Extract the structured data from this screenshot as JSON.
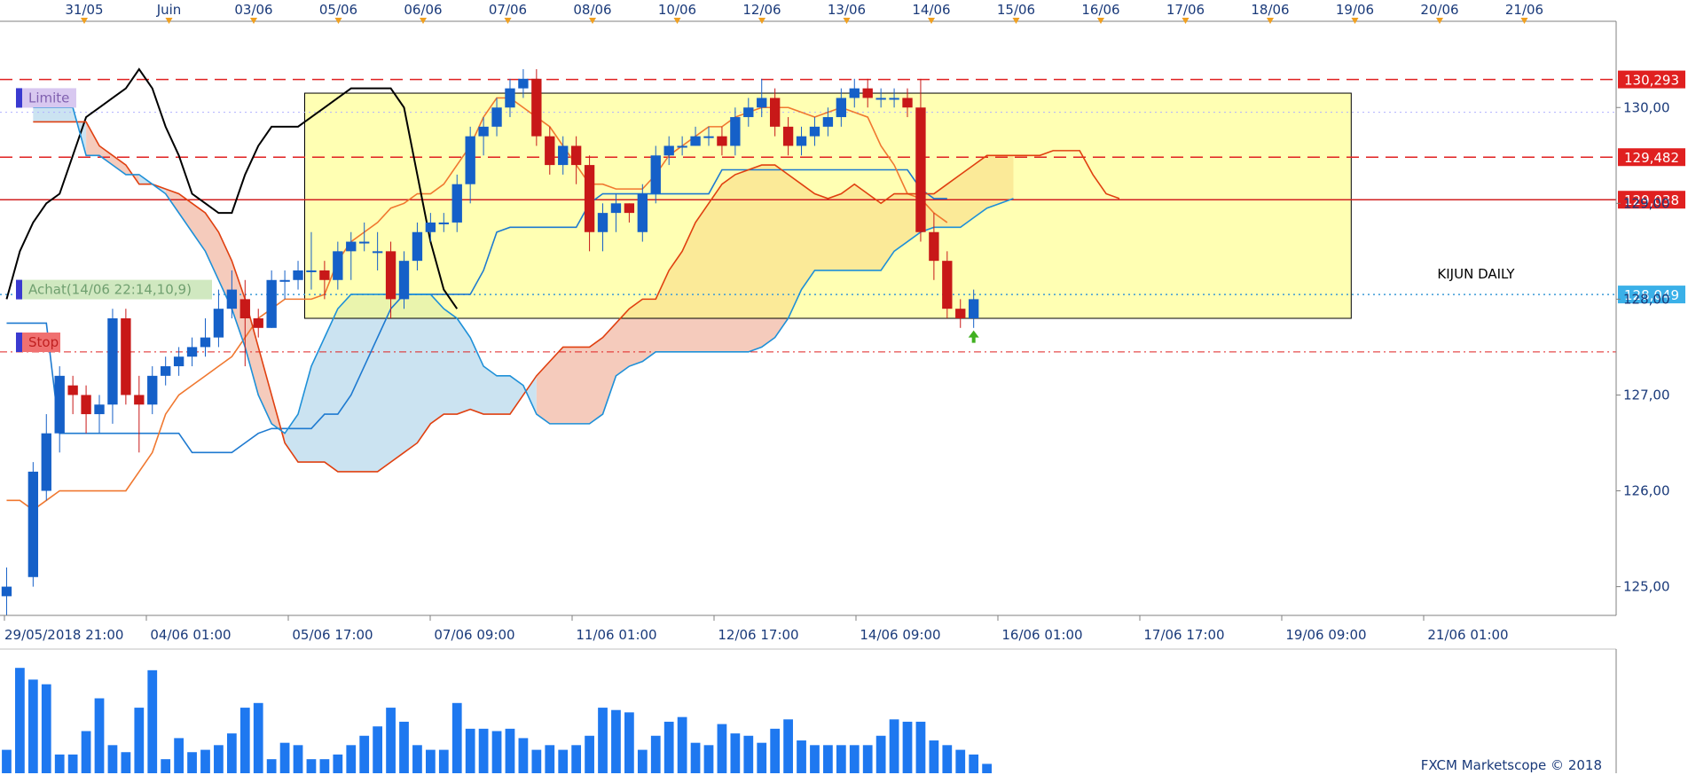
{
  "chart_data": {
    "type": "candlestick",
    "title": "",
    "top_dates": [
      "31/05",
      "Juin",
      "03/06",
      "05/06",
      "06/06",
      "07/06",
      "08/06",
      "10/06",
      "12/06",
      "13/06",
      "14/06",
      "15/06",
      "16/06",
      "17/06",
      "18/06",
      "19/06",
      "20/06",
      "21/06"
    ],
    "x_ticks": [
      "29/05/2018 21:00",
      "04/06 01:00",
      "05/06 17:00",
      "07/06 09:00",
      "11/06 01:00",
      "12/06 17:00",
      "14/06 09:00",
      "16/06 01:00",
      "17/06 17:00",
      "19/06 09:00",
      "21/06 01:00"
    ],
    "y_ticks": [
      "125,00",
      "126,00",
      "127,00",
      "128,00",
      "129,00",
      "130,00"
    ],
    "ylim": [
      124.7,
      130.9
    ],
    "n_slots": 122,
    "price_levels": [
      {
        "label": "130,293",
        "value": 130.293,
        "line_color": "#e02020",
        "style": "dash",
        "box_color": "#e02020"
      },
      {
        "label": "129,482",
        "value": 129.482,
        "line_color": "#e02020",
        "style": "dash",
        "box_color": "#e02020"
      },
      {
        "label": "129,038",
        "value": 129.038,
        "line_color": "#d02020",
        "style": "solid",
        "box_color": "#e02020"
      },
      {
        "label": "128,049",
        "value": 128.049,
        "line_color": "#3a9ad8",
        "style": "dot",
        "box_color": "#3ab0e8"
      }
    ],
    "extra_levels": [
      {
        "value": 127.45,
        "line_color": "#e02020",
        "style": "dashdot"
      },
      {
        "value": 129.95,
        "line_color": "#b0b0ff",
        "style": "dot"
      }
    ],
    "markers": [
      {
        "text": "Limite",
        "value": 130.1,
        "bg": "#d8c8f0",
        "color": "#8060b0"
      },
      {
        "text": "Achat(14/06 22:14,10,9)",
        "value": 128.1,
        "bg": "#d0e8c0",
        "color": "#70a070"
      },
      {
        "text": "Stop",
        "value": 127.55,
        "bg": "#f07070",
        "color": "#c02020"
      }
    ],
    "annotation": "KIJUN DAILY",
    "rectangle": {
      "from_slot": 23,
      "to_slot": 101,
      "top": 130.15,
      "bottom": 127.8,
      "fill": "#ffff80"
    },
    "buy_arrow": {
      "slot": 73,
      "value": 127.6
    },
    "candles": [
      [
        124.9,
        125.0,
        124.7,
        125.2
      ],
      [
        125.1,
        126.2,
        125.0,
        126.3
      ],
      [
        126.0,
        126.6,
        125.9,
        126.8
      ],
      [
        126.6,
        127.2,
        126.4,
        127.3
      ],
      [
        127.1,
        127.0,
        126.8,
        127.2
      ],
      [
        127.0,
        126.8,
        126.6,
        127.1
      ],
      [
        126.8,
        126.9,
        126.6,
        127.0
      ],
      [
        126.9,
        127.8,
        126.7,
        127.9
      ],
      [
        127.8,
        127.0,
        126.9,
        127.9
      ],
      [
        127.0,
        126.9,
        126.4,
        127.2
      ],
      [
        126.9,
        127.2,
        126.8,
        127.3
      ],
      [
        127.2,
        127.3,
        127.1,
        127.4
      ],
      [
        127.3,
        127.4,
        127.2,
        127.5
      ],
      [
        127.4,
        127.5,
        127.3,
        127.6
      ],
      [
        127.5,
        127.6,
        127.4,
        127.8
      ],
      [
        127.6,
        127.9,
        127.5,
        128.1
      ],
      [
        127.9,
        128.1,
        127.8,
        128.3
      ],
      [
        128.0,
        127.8,
        127.3,
        128.2
      ],
      [
        127.8,
        127.7,
        127.6,
        127.9
      ],
      [
        127.7,
        128.2,
        127.7,
        128.3
      ],
      [
        128.2,
        128.2,
        128.0,
        128.3
      ],
      [
        128.2,
        128.3,
        128.1,
        128.4
      ],
      [
        128.3,
        128.3,
        128.1,
        128.7
      ],
      [
        128.3,
        128.2,
        128.0,
        128.4
      ],
      [
        128.2,
        128.5,
        128.1,
        128.6
      ],
      [
        128.5,
        128.6,
        128.2,
        128.7
      ],
      [
        128.6,
        128.6,
        128.5,
        128.8
      ],
      [
        128.5,
        128.5,
        128.3,
        128.7
      ],
      [
        128.5,
        128.0,
        127.8,
        128.6
      ],
      [
        128.0,
        128.4,
        127.9,
        128.5
      ],
      [
        128.4,
        128.7,
        128.3,
        128.8
      ],
      [
        128.7,
        128.8,
        128.6,
        128.9
      ],
      [
        128.8,
        128.8,
        128.7,
        128.9
      ],
      [
        128.8,
        129.2,
        128.7,
        129.3
      ],
      [
        129.2,
        129.7,
        129.0,
        129.8
      ],
      [
        129.7,
        129.8,
        129.5,
        129.9
      ],
      [
        129.8,
        130.0,
        129.7,
        130.1
      ],
      [
        130.0,
        130.2,
        129.9,
        130.3
      ],
      [
        130.2,
        130.3,
        130.1,
        130.4
      ],
      [
        130.3,
        129.7,
        129.6,
        130.4
      ],
      [
        129.7,
        129.4,
        129.3,
        129.8
      ],
      [
        129.4,
        129.6,
        129.3,
        129.7
      ],
      [
        129.6,
        129.4,
        129.2,
        129.7
      ],
      [
        129.4,
        128.7,
        128.5,
        129.5
      ],
      [
        128.7,
        128.9,
        128.5,
        129.0
      ],
      [
        128.9,
        129.0,
        128.7,
        129.1
      ],
      [
        129.0,
        128.9,
        128.8,
        129.0
      ],
      [
        128.7,
        129.1,
        128.6,
        129.2
      ],
      [
        129.1,
        129.5,
        129.0,
        129.6
      ],
      [
        129.5,
        129.6,
        129.4,
        129.7
      ],
      [
        129.6,
        129.6,
        129.5,
        129.7
      ],
      [
        129.6,
        129.7,
        129.6,
        129.8
      ],
      [
        129.7,
        129.7,
        129.6,
        129.8
      ],
      [
        129.7,
        129.6,
        129.5,
        129.8
      ],
      [
        129.6,
        129.9,
        129.5,
        130.0
      ],
      [
        129.9,
        130.0,
        129.8,
        130.1
      ],
      [
        130.0,
        130.1,
        129.9,
        130.3
      ],
      [
        130.1,
        129.8,
        129.7,
        130.2
      ],
      [
        129.8,
        129.6,
        129.5,
        129.9
      ],
      [
        129.6,
        129.7,
        129.5,
        129.8
      ],
      [
        129.7,
        129.8,
        129.6,
        129.9
      ],
      [
        129.8,
        129.9,
        129.7,
        130.0
      ],
      [
        129.9,
        130.1,
        129.8,
        130.2
      ],
      [
        130.1,
        130.2,
        130.0,
        130.3
      ],
      [
        130.2,
        130.1,
        130.0,
        130.3
      ],
      [
        130.1,
        130.1,
        130.0,
        130.2
      ],
      [
        130.1,
        130.1,
        130.0,
        130.2
      ],
      [
        130.1,
        130.0,
        129.9,
        130.2
      ],
      [
        130.0,
        128.7,
        128.6,
        130.3
      ],
      [
        128.7,
        128.4,
        128.2,
        128.9
      ],
      [
        128.4,
        127.9,
        127.8,
        128.5
      ],
      [
        127.9,
        127.8,
        127.7,
        128.0
      ],
      [
        127.8,
        128.0,
        127.7,
        128.1
      ]
    ],
    "candle_slots": [
      0,
      2,
      3,
      4,
      5,
      6,
      7,
      8,
      9,
      10,
      11,
      12,
      13,
      14,
      15,
      16,
      17,
      18,
      19,
      20,
      21,
      22,
      23,
      24,
      25,
      26,
      27,
      28,
      29,
      30,
      31,
      32,
      33,
      34,
      35,
      36,
      37,
      38,
      39,
      40,
      41,
      42,
      43,
      44,
      45,
      46,
      47,
      48,
      49,
      50,
      51,
      52,
      53,
      54,
      55,
      56,
      57,
      58,
      59,
      60,
      61,
      62,
      63,
      64,
      65,
      66,
      67,
      68,
      69,
      70,
      71,
      72,
      73
    ],
    "lines": [
      {
        "name": "",
        "color": "#1e7ad0",
        "start": 0,
        "values": [
          127.75,
          127.75,
          127.75,
          127.75,
          126.6,
          126.6,
          126.6,
          126.6,
          126.6,
          126.6,
          126.6,
          126.6,
          126.6,
          126.6,
          126.4,
          126.4,
          126.4,
          126.4,
          126.5,
          126.6,
          126.65,
          126.65,
          126.65,
          126.65,
          126.8,
          126.8,
          127.0,
          127.3,
          127.6,
          127.9,
          128.05,
          128.05,
          128.05,
          128.05,
          128.05,
          128.05,
          128.3,
          128.7,
          128.75,
          128.75,
          128.75,
          128.75,
          128.75,
          128.75,
          129.0,
          129.1,
          129.1,
          129.1,
          129.1,
          129.1,
          129.1,
          129.1,
          129.1,
          129.1,
          129.35,
          129.35,
          129.35,
          129.35,
          129.35,
          129.35,
          129.35,
          129.35,
          129.35,
          129.35,
          129.35,
          129.35,
          129.35,
          129.35,
          129.35,
          129.15,
          129.05,
          129.05
        ]
      },
      {
        "name": "",
        "color": "#f07830",
        "start": 0,
        "values": [
          125.9,
          125.9,
          125.8,
          125.9,
          126.0,
          126.0,
          126.0,
          126.0,
          126.0,
          126.0,
          126.2,
          126.4,
          126.8,
          127.0,
          127.1,
          127.2,
          127.3,
          127.4,
          127.6,
          127.8,
          127.9,
          128.0,
          128.0,
          128.0,
          128.05,
          128.4,
          128.6,
          128.7,
          128.8,
          128.95,
          129.0,
          129.1,
          129.1,
          129.2,
          129.4,
          129.6,
          129.9,
          130.1,
          130.1,
          130.0,
          129.9,
          129.8,
          129.6,
          129.4,
          129.2,
          129.2,
          129.15,
          129.15,
          129.15,
          129.3,
          129.5,
          129.6,
          129.7,
          129.8,
          129.8,
          129.9,
          129.95,
          130.0,
          130.0,
          130.0,
          129.95,
          129.9,
          129.95,
          130.0,
          129.95,
          129.9,
          129.6,
          129.4,
          129.1,
          129.05,
          128.9,
          128.8
        ]
      },
      {
        "name": "",
        "color": "#000000",
        "start": 0,
        "values": [
          128.0,
          128.5,
          128.8,
          129.0,
          129.1,
          129.5,
          129.9,
          130.0,
          130.1,
          130.2,
          130.4,
          130.2,
          129.8,
          129.5,
          129.1,
          129.0,
          128.9,
          128.9,
          129.3,
          129.6,
          129.8,
          129.8,
          129.8,
          129.9,
          130.0,
          130.1,
          130.2,
          130.2,
          130.2,
          130.2,
          130.0,
          129.3,
          128.6,
          128.1,
          127.9
        ]
      },
      {
        "name": "",
        "color": "#e04010",
        "start": 2,
        "values": [
          129.85,
          129.85,
          129.85,
          129.85,
          129.85,
          129.6,
          129.5,
          129.4,
          129.2,
          129.2,
          129.15,
          129.1,
          129.0,
          128.9,
          128.7,
          128.4,
          128.0,
          127.5,
          127.0,
          126.5,
          126.3,
          126.3,
          126.3,
          126.2,
          126.2,
          126.2,
          126.2,
          126.3,
          126.4,
          126.5,
          126.7,
          126.8,
          126.8,
          126.85,
          126.8,
          126.8,
          126.8,
          127.0,
          127.2,
          127.35,
          127.5,
          127.5,
          127.5,
          127.6,
          127.75,
          127.9,
          128.0,
          128.0,
          128.3,
          128.5,
          128.8,
          129.0,
          129.2,
          129.3,
          129.35,
          129.4,
          129.4,
          129.3,
          129.2,
          129.1,
          129.05,
          129.1,
          129.2,
          129.1,
          129.0,
          129.1,
          129.1,
          129.1,
          129.1,
          129.2,
          129.3,
          129.4,
          129.5,
          129.5,
          129.5,
          129.5,
          129.5,
          129.55,
          129.55,
          129.55,
          129.3,
          129.1,
          129.05
        ]
      },
      {
        "name": "",
        "color": "#1e90d8",
        "start": 2,
        "values": [
          130.0,
          130.0,
          130.0,
          130.0,
          129.5,
          129.5,
          129.4,
          129.3,
          129.3,
          129.2,
          129.1,
          128.9,
          128.7,
          128.5,
          128.2,
          127.9,
          127.5,
          127.0,
          126.7,
          126.6,
          126.8,
          127.3,
          127.6,
          127.9,
          128.05,
          128.05,
          128.05,
          128.05,
          128.05,
          128.05,
          128.05,
          127.9,
          127.8,
          127.6,
          127.3,
          127.2,
          127.2,
          127.1,
          126.8,
          126.7,
          126.7,
          126.7,
          126.7,
          126.8,
          127.2,
          127.3,
          127.35,
          127.45,
          127.45,
          127.45,
          127.45,
          127.45,
          127.45,
          127.45,
          127.45,
          127.5,
          127.6,
          127.8,
          128.1,
          128.3,
          128.3,
          128.3,
          128.3,
          128.3,
          128.3,
          128.5,
          128.6,
          128.7,
          128.75,
          128.75,
          128.75,
          128.85,
          128.95,
          129.0,
          129.05
        ]
      }
    ],
    "volume": [
      10,
      45,
      40,
      38,
      8,
      8,
      18,
      32,
      12,
      9,
      28,
      44,
      6,
      15,
      9,
      10,
      12,
      17,
      28,
      30,
      6,
      13,
      12,
      6,
      6,
      8,
      12,
      16,
      20,
      28,
      22,
      12,
      10,
      10,
      30,
      19,
      19,
      18,
      19,
      15,
      10,
      12,
      10,
      12,
      16,
      28,
      27,
      26,
      10,
      16,
      22,
      24,
      13,
      12,
      21,
      17,
      16,
      13,
      19,
      23,
      14,
      12,
      12,
      12,
      12,
      12,
      16,
      23,
      22,
      22,
      14,
      12,
      10,
      8,
      4
    ],
    "volume_slots": [
      0,
      1,
      2,
      3,
      4,
      5,
      6,
      7,
      8,
      9,
      10,
      11,
      12,
      13,
      14,
      15,
      16,
      17,
      18,
      19,
      20,
      21,
      22,
      23,
      24,
      25,
      26,
      27,
      28,
      29,
      30,
      31,
      32,
      33,
      34,
      35,
      36,
      37,
      38,
      39,
      40,
      41,
      42,
      43,
      44,
      45,
      46,
      47,
      48,
      49,
      50,
      51,
      52,
      53,
      54,
      55,
      56,
      57,
      58,
      59,
      60,
      61,
      62,
      63,
      64,
      65,
      66,
      67,
      68,
      69,
      70,
      71,
      72,
      73,
      74
    ],
    "colors": {
      "up": "#1560c8",
      "down": "#c81818",
      "volume": "#1e78f0",
      "axis_text": "#1a3a7a",
      "kumo_bear": "#f4c8b8",
      "kumo_bull": "#c8e2f0",
      "rect_overlap": "#ffc860"
    },
    "copyright": "FXCM Marketscope © 2018"
  }
}
